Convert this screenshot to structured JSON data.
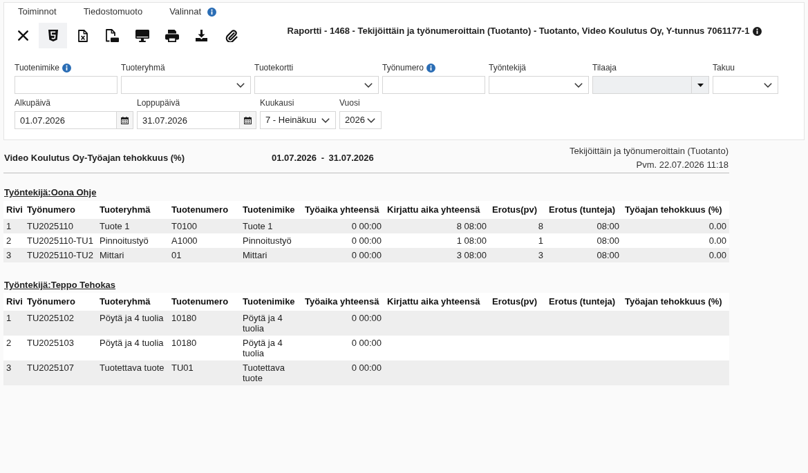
{
  "menu": [
    {
      "label": "Toiminnot",
      "info": false
    },
    {
      "label": "Tiedostomuoto",
      "info": false
    },
    {
      "label": "Valinnat",
      "info": true
    }
  ],
  "toolbar": [
    {
      "kind": "close",
      "selected": false
    },
    {
      "kind": "html",
      "selected": true
    },
    {
      "kind": "excel",
      "selected": false
    },
    {
      "kind": "pdf",
      "selected": false
    },
    {
      "kind": "screen",
      "selected": false
    },
    {
      "kind": "print",
      "selected": false
    },
    {
      "kind": "download",
      "selected": false
    },
    {
      "kind": "attach",
      "selected": false
    }
  ],
  "report_title": {
    "text": "Raportti - 1468 - Tekijöittäin ja työnumeroittain (Tuotanto) - Tuotanto, Video Koulutus Oy, Y-tunnus 7061177-1",
    "info": true
  },
  "filter_rows": [
    {
      "fields": [
        {
          "kind": "text",
          "label": "Tuotenimike",
          "info": true,
          "disabled": false
        },
        {
          "kind": "select",
          "label": "Tuoteryhmä",
          "info": false,
          "disabled": false
        },
        {
          "kind": "select",
          "label": "Tuotekortti",
          "info": false,
          "disabled": false
        },
        {
          "kind": "text",
          "label": "Työnumero",
          "info": true,
          "disabled": false
        },
        {
          "kind": "select",
          "label": "Työntekijä",
          "info": false,
          "disabled": false
        },
        {
          "kind": "combo",
          "label": "Tilaaja",
          "info": false,
          "disabled": true
        },
        {
          "kind": "select",
          "label": "Takuu",
          "info": false,
          "disabled": false
        }
      ]
    },
    {
      "fields": [
        {
          "kind": "date",
          "label": "Alkupäivä",
          "info": false,
          "disabled": false,
          "value": "01.07.2026"
        },
        {
          "kind": "date",
          "label": "Loppupäivä",
          "info": false,
          "disabled": false,
          "value": "31.07.2026"
        },
        {
          "kind": "select",
          "label": "Kuukausi",
          "info": false,
          "disabled": false,
          "value": "7 - Heinäkuu"
        },
        {
          "kind": "select",
          "label": "Vuosi",
          "info": false,
          "disabled": false,
          "value": "2026"
        }
      ]
    }
  ],
  "report": {
    "title": "Video Koulutus Oy-Työajan tehokkuus (%)",
    "period": "01.07.2026 - 31.07.2026",
    "subtitle": "Tekijöittäin ja työnumeroittain (Tuotanto)",
    "printed": "Pvm. 22.07.2026 11:18",
    "groups": [
      {
        "heading": "Työntekijä:Oona Ohje",
        "columns": [
          "Rivi",
          "Työnumero",
          "Tuoteryhmä",
          "Tuotenumero",
          "Tuotenimike",
          "Työaika yhteensä",
          "Kirjattu aika yhteensä",
          "Erotus(pv)",
          "Erotus (tunteja)",
          "Työajan tehokkuus (%)"
        ],
        "rows": [
          [
            "1",
            "TU2025110",
            "Tuote 1",
            "T0100",
            "Tuote 1",
            "0 00:00",
            "8 08:00",
            "8",
            "08:00",
            "0.00"
          ],
          [
            "2",
            "TU2025110-TU1",
            "Pinnoitustyö",
            "A1000",
            "Pinnoitustyö",
            "0 00:00",
            "1 08:00",
            "1",
            "08:00",
            "0.00"
          ],
          [
            "3",
            "TU2025110-TU2",
            "Mittari",
            "01",
            "Mittari",
            "0 00:00",
            "3 08:00",
            "3",
            "08:00",
            "0.00"
          ]
        ]
      },
      {
        "heading": "Työntekijä:Teppo Tehokas",
        "columns": [
          "Rivi",
          "Työnumero",
          "Tuoteryhmä",
          "Tuotenumero",
          "Tuotenimike",
          "Työaika yhteensä",
          "Kirjattu aika yhteensä",
          "Erotus(pv)",
          "Erotus (tunteja)",
          "Työajan tehokkuus (%)"
        ],
        "rows": [
          [
            "1",
            "TU2025102",
            "Pöytä ja 4 tuolia",
            "10180",
            "Pöytä ja 4 tuolia",
            "0 00:00"
          ],
          [
            "2",
            "TU2025103",
            "Pöytä ja 4 tuolia",
            "10180",
            "Pöytä ja 4 tuolia",
            "0 00:00"
          ],
          [
            "3",
            "TU2025107",
            "Tuotettava tuote",
            "TU01",
            "Tuotettava tuote",
            "0 00:00"
          ]
        ]
      }
    ]
  }
}
